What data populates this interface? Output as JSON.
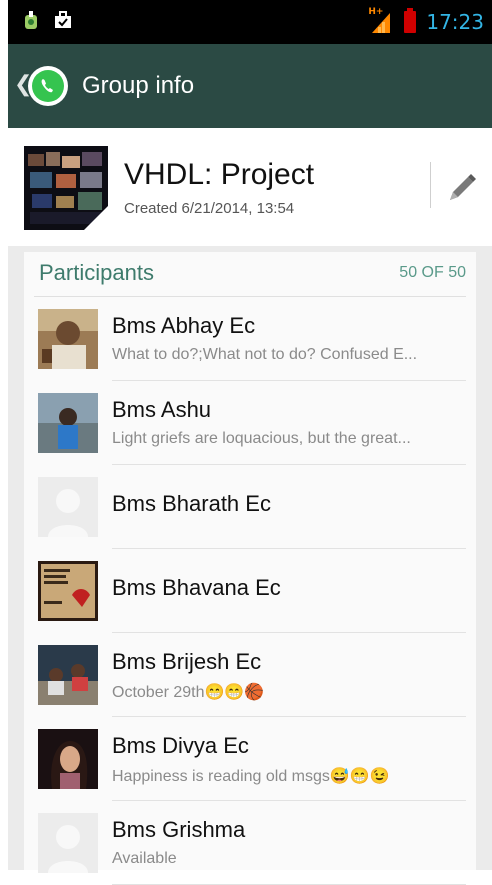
{
  "status_bar": {
    "time": "17:23",
    "network_label": "H+",
    "left_icons": [
      "download-icon",
      "briefcase-icon"
    ],
    "accent_color": "#33b5e5"
  },
  "action_bar": {
    "title": "Group info",
    "back_icon": "chevron-left-icon",
    "logo_icon": "whatsapp-logo",
    "background": "#2b4a44"
  },
  "group": {
    "name": "VHDL: Project",
    "created": "Created 6/21/2014, 13:54",
    "edit_icon": "pencil-icon"
  },
  "participants": {
    "title": "Participants",
    "count": "50 OF 50",
    "items": [
      {
        "name": "Bms Abhay Ec",
        "status": "What to do?;What not to do? Confused E...",
        "avatar": "photo"
      },
      {
        "name": "Bms Ashu",
        "status": "Light griefs are loquacious, but the great...",
        "avatar": "photo"
      },
      {
        "name": "Bms Bharath Ec",
        "status": "",
        "avatar": "default"
      },
      {
        "name": "Bms Bhavana Ec",
        "status": "",
        "avatar": "photo"
      },
      {
        "name": "Bms Brijesh Ec",
        "status": "October 29th😁😁🏀",
        "avatar": "photo"
      },
      {
        "name": "Bms Divya Ec",
        "status": "Happiness is reading old msgs😅😁😉",
        "avatar": "photo"
      },
      {
        "name": "Bms Grishma",
        "status": "Available",
        "avatar": "default"
      }
    ]
  }
}
